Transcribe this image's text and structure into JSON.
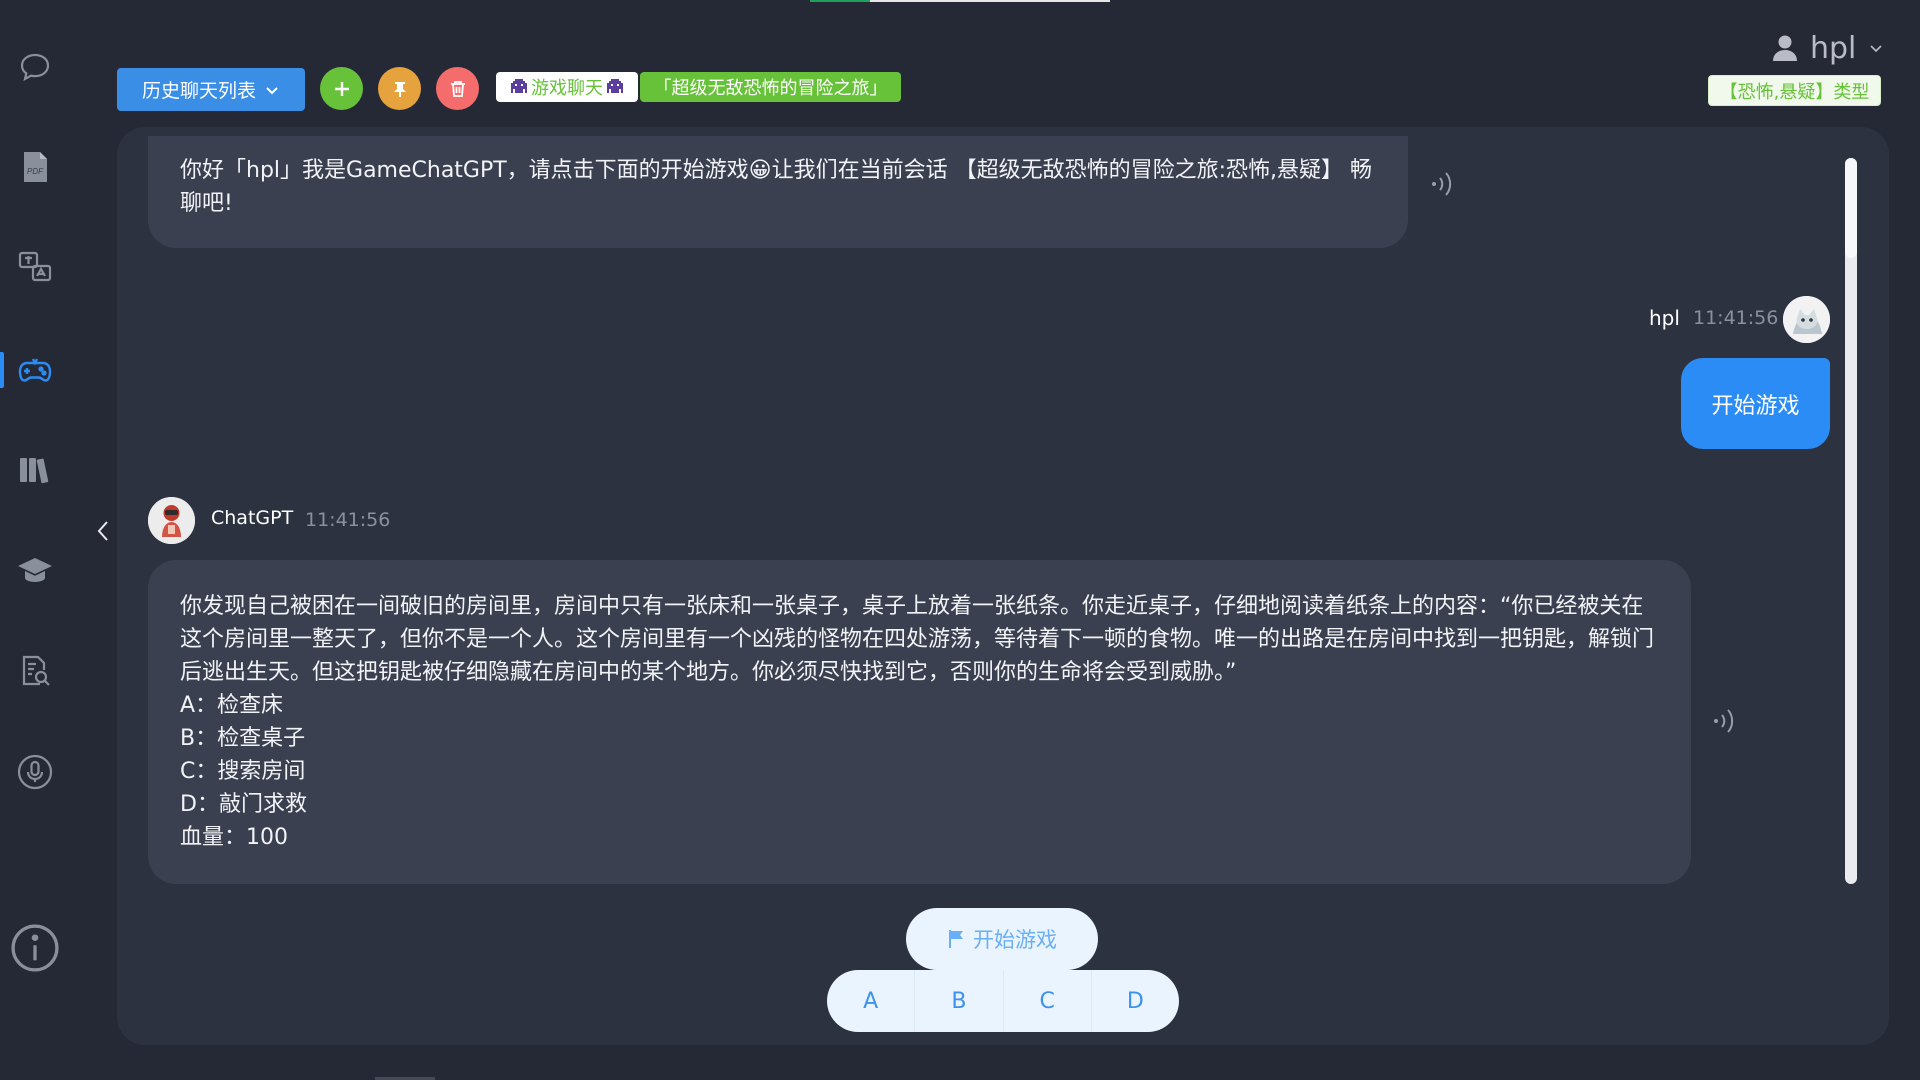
{
  "sidebar": {
    "items": [
      {
        "name": "chat-icon"
      },
      {
        "name": "pdf-icon",
        "label": "PDF"
      },
      {
        "name": "translate-icon"
      },
      {
        "name": "game-controller-icon",
        "active": true
      },
      {
        "name": "library-icon"
      },
      {
        "name": "graduation-cap-icon"
      },
      {
        "name": "document-search-icon"
      },
      {
        "name": "microphone-icon"
      },
      {
        "name": "info-icon"
      }
    ]
  },
  "toolbar": {
    "history_label": "历史聊天列表",
    "game_tag": "游戏聊天",
    "story_title": "「超级无敌恐怖的冒险之旅」"
  },
  "user_menu": {
    "username": "hpl"
  },
  "type_tag": "【恐怖,悬疑】类型",
  "messages": {
    "welcome": "你好「hpl」我是GameChatGPT，请点击下面的开始游戏😀让我们在当前会话 【超级无敌恐怖的冒险之旅:恐怖,悬疑】 畅聊吧!",
    "user": {
      "name": "hpl",
      "time": "11:41:56",
      "text": "开始游戏"
    },
    "ai": {
      "name": "ChatGPT",
      "time": "11:41:56",
      "story": "你发现自己被困在一间破旧的房间里，房间中只有一张床和一张桌子，桌子上放着一张纸条。你走近桌子，仔细地阅读着纸条上的内容：“你已经被关在这个房间里一整天了，但你不是一个人。这个房间里有一个凶残的怪物在四处游荡，等待着下一顿的食物。唯一的出路是在房间中找到一把钥匙，解锁门后逃出生天。但这把钥匙被仔细隐藏在房间中的某个地方。你必须尽快找到它，否则你的生命将会受到威胁。”",
      "option_a": "A：检查床",
      "option_b": "B：检查桌子",
      "option_c": "C：搜索房间",
      "option_d": "D：敲门求救",
      "health": "血量：100"
    }
  },
  "actions": {
    "start_label": "开始游戏",
    "options": [
      "A",
      "B",
      "C",
      "D"
    ]
  },
  "colors": {
    "background": "#252935",
    "panel": "#2d3240",
    "bubble": "#3b4050",
    "accent_blue": "#2b8cf5",
    "green": "#67c23a",
    "orange": "#e6a23c",
    "red": "#f56c6c"
  }
}
